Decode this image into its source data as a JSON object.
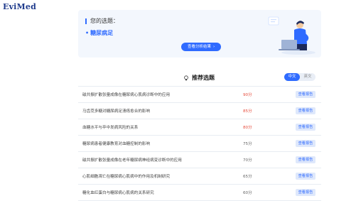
{
  "brand": {
    "logo": "EviMed"
  },
  "topic": {
    "title": "您的选题：",
    "item": "糖尿病足",
    "analysis_button": "查看分析结果",
    "analysis_chevron": "›"
  },
  "recommend": {
    "title": "推荐选题",
    "icon": "bulb-icon",
    "lang": [
      "中文",
      "英文"
    ],
    "rows": [
      {
        "title": "磁共振扩散张量成像在糖尿病心肌病诊断中的应用",
        "score": "90分",
        "score_color": "#e74c3c",
        "button": "查看报告"
      },
      {
        "title": "马齿苋多糖对糖尿病足溃疡愈合的影响",
        "score": "85分",
        "score_color": "#e74c3c",
        "button": "查看报告"
      },
      {
        "title": "血糖水平与卒中发病风险的关系",
        "score": "80分",
        "score_color": "#e74c3c",
        "button": "查看报告"
      },
      {
        "title": "糖尿病患者健康教育对血糖控制的影响",
        "score": "75分",
        "score_color": "#666666",
        "button": "查看报告"
      },
      {
        "title": "磁共振扩散张量成像在老年糖尿病神经病变诊断中的应用",
        "score": "70分",
        "score_color": "#666666",
        "button": "查看报告"
      },
      {
        "title": "心肌细胞凋亡在糖尿病心肌病中的作用及机制研究",
        "score": "65分",
        "score_color": "#666666",
        "button": "查看报告"
      },
      {
        "title": "糖化血红蛋白与糖尿病心肌病的关系研究",
        "score": "60分",
        "score_color": "#666666",
        "button": "查看报告"
      }
    ]
  }
}
